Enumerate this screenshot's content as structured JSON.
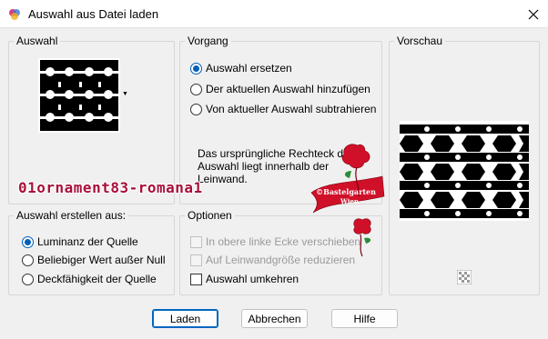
{
  "window": {
    "title": "Auswahl aus Datei laden"
  },
  "groups": {
    "auswahl": "Auswahl",
    "vorgang": "Vorgang",
    "vorschau": "Vorschau",
    "erstellen": "Auswahl erstellen aus:",
    "optionen": "Optionen"
  },
  "vorgang_options": [
    {
      "label": "Auswahl ersetzen",
      "checked": true
    },
    {
      "label": "Der aktuellen Auswahl hinzufügen",
      "checked": false
    },
    {
      "label": "Von aktueller Auswahl subtrahieren",
      "checked": false
    }
  ],
  "info_text": "Das ursprüngliche Rechteck dieser Auswahl liegt innerhalb der Leinwand.",
  "erstellen_options": [
    {
      "label": "Luminanz der Quelle",
      "checked": true
    },
    {
      "label": "Beliebiger Wert außer Null",
      "checked": false
    },
    {
      "label": "Deckfähigkeit der Quelle",
      "checked": false
    }
  ],
  "optionen": [
    {
      "label": "In obere linke Ecke verschieben",
      "checked": false,
      "disabled": true
    },
    {
      "label": "Auf Leinwandgröße reduzieren",
      "checked": false,
      "disabled": true
    },
    {
      "label": "Auswahl umkehren",
      "checked": false,
      "disabled": false
    }
  ],
  "buttons": {
    "laden": "Laden",
    "abbrechen": "Abbrechen",
    "hilfe": "Hilfe"
  },
  "watermark": "01ornament83-romana1",
  "stamp": {
    "line1": "©Bastelgarten",
    "line2": "Wien"
  },
  "colors": {
    "accent": "#005fb8",
    "watermark": "#a8103a",
    "stamp": "#d01028"
  }
}
